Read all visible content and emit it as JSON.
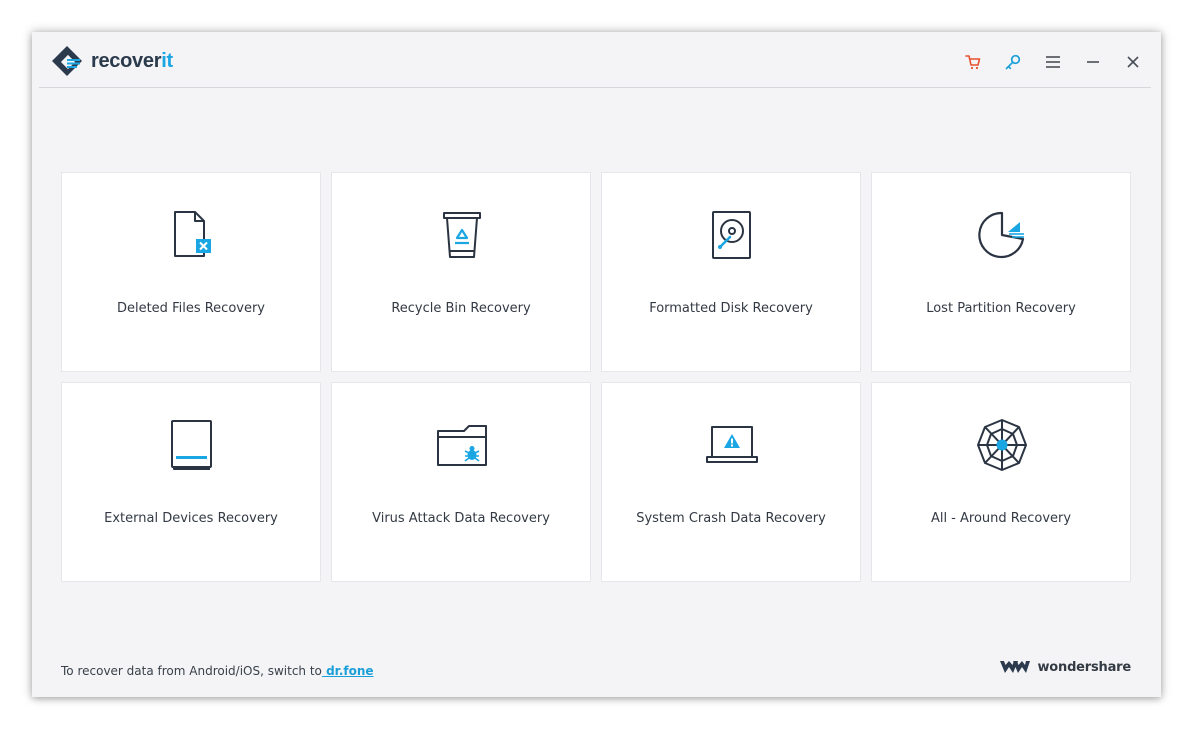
{
  "app": {
    "name_main": "recover",
    "name_accent": "it"
  },
  "titlebar": {
    "controls": [
      {
        "name": "cart-icon",
        "color": "#e8502f"
      },
      {
        "name": "key-icon",
        "color": "#1a9fd9"
      },
      {
        "name": "menu-icon",
        "color": "#4a4f57"
      },
      {
        "name": "minimize-icon",
        "color": "#4a4f57"
      },
      {
        "name": "close-icon",
        "color": "#4a4f57"
      }
    ]
  },
  "cards": [
    {
      "label": "Deleted Files Recovery",
      "icon": "deleted-file-icon"
    },
    {
      "label": "Recycle Bin Recovery",
      "icon": "recycle-bin-icon"
    },
    {
      "label": "Formatted Disk Recovery",
      "icon": "hard-disk-icon"
    },
    {
      "label": "Lost Partition Recovery",
      "icon": "pie-partition-icon"
    },
    {
      "label": "External Devices Recovery",
      "icon": "external-drive-icon"
    },
    {
      "label": "Virus Attack Data Recovery",
      "icon": "virus-folder-icon"
    },
    {
      "label": "System Crash Data Recovery",
      "icon": "laptop-warning-icon"
    },
    {
      "label": "All - Around Recovery",
      "icon": "web-network-icon"
    }
  ],
  "footer": {
    "text": "To recover data from Android/iOS, switch to",
    "link": " dr.fone"
  },
  "vendor": {
    "name": "wondershare"
  },
  "colors": {
    "accent": "#1aa6e3",
    "icon_stroke": "#2b3442",
    "card_bg": "#ffffff",
    "window_bg": "#f4f4f6"
  }
}
